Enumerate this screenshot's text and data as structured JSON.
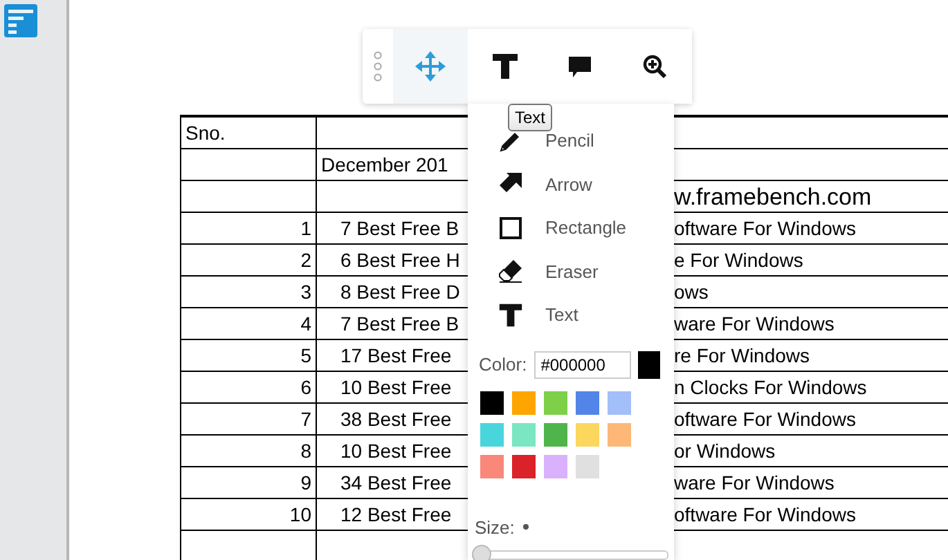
{
  "toolbar": {
    "buttons": [
      {
        "kind": "move",
        "selected": true
      },
      {
        "kind": "text",
        "selected": false
      },
      {
        "kind": "comment",
        "selected": false
      },
      {
        "kind": "zoom",
        "selected": false
      }
    ]
  },
  "tooltip": "Text",
  "tools_menu": {
    "items": [
      {
        "kind": "pencil",
        "label": "Pencil"
      },
      {
        "kind": "arrow",
        "label": "Arrow"
      },
      {
        "kind": "rectangle",
        "label": "Rectangle"
      },
      {
        "kind": "eraser",
        "label": "Eraser"
      },
      {
        "kind": "text",
        "label": "Text"
      }
    ],
    "color_label": "Color:",
    "color_value": "#000000",
    "palette": [
      {
        "color": "#000000"
      },
      {
        "color": "#ffa500"
      },
      {
        "color": "#7ed048"
      },
      {
        "color": "#5385e8"
      },
      {
        "color": "#a3bff9"
      },
      {
        "color": "#48d6dc"
      },
      {
        "color": "#7ae6c2"
      },
      {
        "color": "#4fb54b"
      },
      {
        "color": "#fcd75e"
      },
      {
        "color": "#fdb877"
      },
      {
        "color": "#fa887a"
      },
      {
        "color": "#dc2229"
      },
      {
        "color": "#dab1fc"
      },
      {
        "color": "#e0e0e0"
      }
    ],
    "size_label": "Size:",
    "size": {
      "level": 0
    }
  },
  "table": {
    "rows": [
      {
        "kind": "header",
        "number": "Sno.",
        "left": "",
        "right": ""
      },
      {
        "kind": "header",
        "number": "",
        "left": "December 201",
        "right": ""
      },
      {
        "kind": "link",
        "number": "",
        "left": "",
        "right": "w.framebench.com"
      },
      {
        "kind": "item",
        "number": "1",
        "left": "7 Best Free B",
        "right": "oftware For Windows"
      },
      {
        "kind": "item",
        "number": "2",
        "left": "6 Best Free H",
        "right": "e For Windows"
      },
      {
        "kind": "item",
        "number": "3",
        "left": "8 Best Free D",
        "right": "ows"
      },
      {
        "kind": "item",
        "number": "4",
        "left": "7 Best Free B",
        "right": "ware For Windows"
      },
      {
        "kind": "item",
        "number": "5",
        "left": "17 Best Free",
        "right": "re For Windows"
      },
      {
        "kind": "item",
        "number": "6",
        "left": "10 Best Free",
        "right": "n Clocks For Windows"
      },
      {
        "kind": "item",
        "number": "7",
        "left": "38 Best Free",
        "right": "oftware For Windows"
      },
      {
        "kind": "item",
        "number": "8",
        "left": "10 Best Free",
        "right": "or Windows"
      },
      {
        "kind": "item",
        "number": "9",
        "left": "34 Best Free",
        "right": "ware For Windows"
      },
      {
        "kind": "item",
        "number": "10",
        "left": "12 Best Free",
        "right": "oftware For Windows"
      },
      {
        "kind": "item",
        "number": "",
        "left": "",
        "right": ""
      }
    ]
  }
}
